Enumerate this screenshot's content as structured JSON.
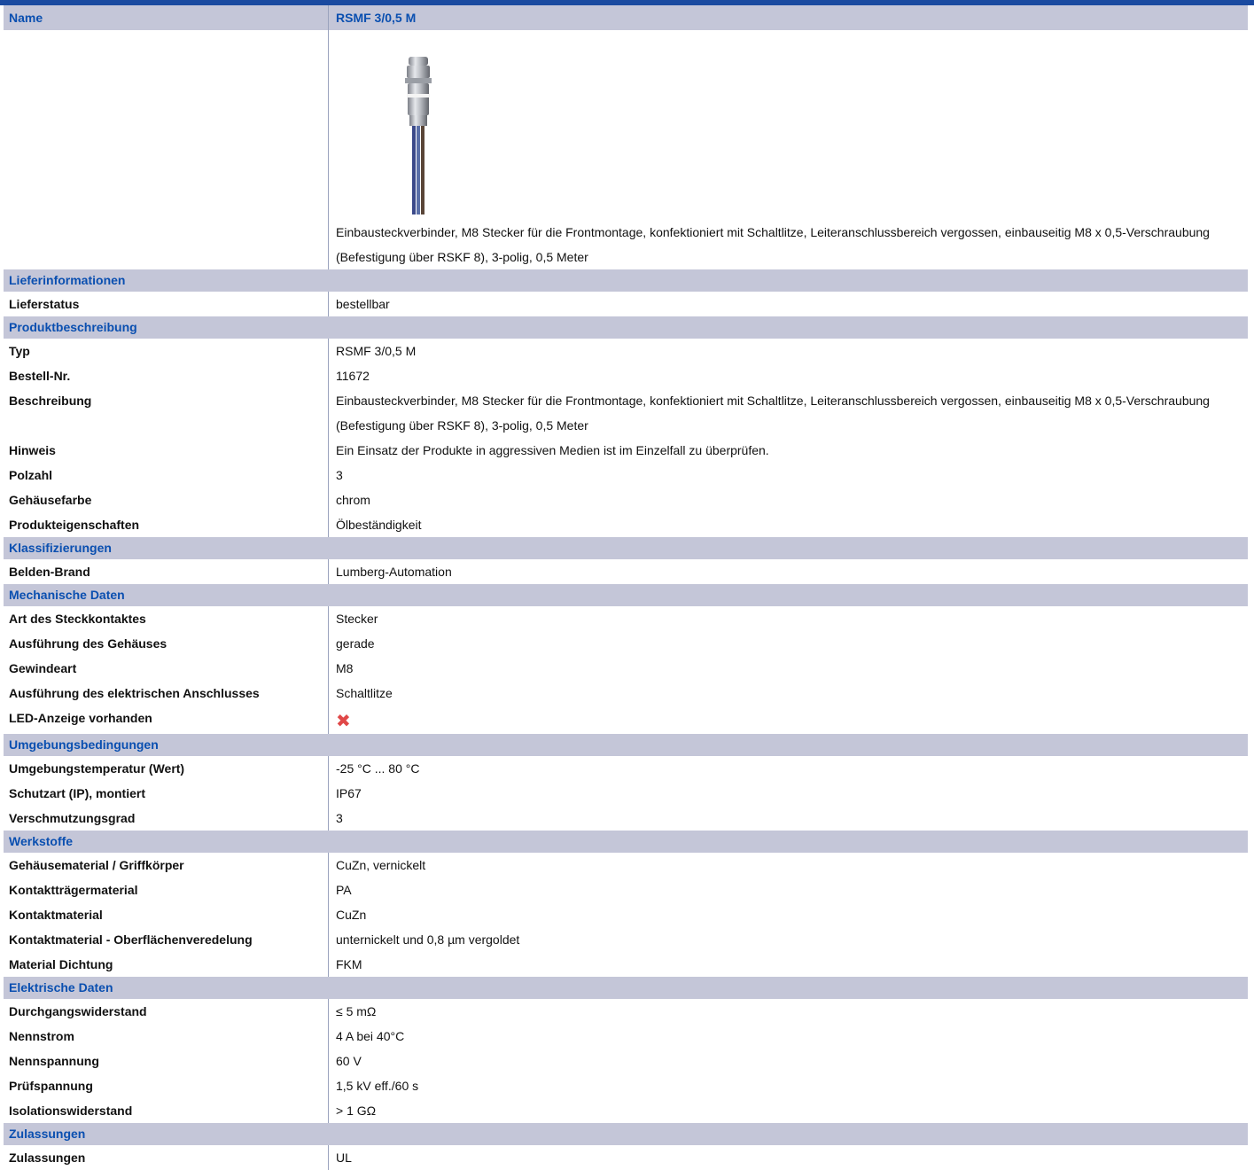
{
  "header": {
    "name_label": "Name",
    "name_value": "RSMF 3/0,5 M"
  },
  "intro_description": "Einbausteckverbinder, M8 Stecker für die Frontmontage, konfektioniert mit Schaltlitze, Leiteranschlussbereich vergossen, einbauseitig M8 x 0,5-Verschraubung (Befestigung über RSKF 8), 3-polig, 0,5 Meter",
  "sections": {
    "liefer": "Lieferinformationen",
    "produkt": "Produktbeschreibung",
    "klass": "Klassifizierungen",
    "mech": "Mechanische Daten",
    "umgebung": "Umgebungsbedingungen",
    "werk": "Werkstoffe",
    "elek": "Elektrische Daten",
    "zul": "Zulassungen"
  },
  "rows": {
    "lieferstatus": {
      "label": "Lieferstatus",
      "value": "bestellbar"
    },
    "typ": {
      "label": "Typ",
      "value": "RSMF 3/0,5 M"
    },
    "bestellnr": {
      "label": "Bestell-Nr.",
      "value": "11672"
    },
    "beschreibung": {
      "label": "Beschreibung",
      "value": "Einbausteckverbinder, M8 Stecker für die Frontmontage, konfektioniert mit Schaltlitze, Leiteranschlussbereich vergossen, einbauseitig M8 x 0,5-Verschraubung (Befestigung über RSKF 8), 3-polig, 0,5 Meter"
    },
    "hinweis": {
      "label": "Hinweis",
      "value": "Ein Einsatz der Produkte in aggressiven Medien ist im Einzelfall zu überprüfen."
    },
    "polzahl": {
      "label": "Polzahl",
      "value": "3"
    },
    "farbe": {
      "label": "Gehäusefarbe",
      "value": "chrom"
    },
    "eigenschaften": {
      "label": "Produkteigenschaften",
      "value": "Ölbeständigkeit"
    },
    "brand": {
      "label": "Belden-Brand",
      "value": "Lumberg-Automation"
    },
    "kontaktart": {
      "label": "Art des Steckkontaktes",
      "value": "Stecker"
    },
    "gehaeuse": {
      "label": "Ausführung des Gehäuses",
      "value": "gerade"
    },
    "gewinde": {
      "label": "Gewindeart",
      "value": "M8"
    },
    "anschluss": {
      "label": "Ausführung des elektrischen Anschlusses",
      "value": "Schaltlitze"
    },
    "led": {
      "label": "LED-Anzeige vorhanden",
      "value_icon": "cross-icon",
      "icon_color": "#e04848"
    },
    "temp": {
      "label": "Umgebungstemperatur (Wert)",
      "value": "-25 °C ... 80 °C"
    },
    "schutzart": {
      "label": "Schutzart (IP), montiert",
      "value": "IP67"
    },
    "verschmutzung": {
      "label": "Verschmutzungsgrad",
      "value": "3"
    },
    "griffkoerper": {
      "label": "Gehäusematerial / Griffkörper",
      "value": "CuZn, vernickelt"
    },
    "traeger": {
      "label": "Kontaktträgermaterial",
      "value": "PA"
    },
    "kontaktmat": {
      "label": "Kontaktmaterial",
      "value": "CuZn"
    },
    "oberflaeche": {
      "label": "Kontaktmaterial - Oberflächenveredelung",
      "value": "unternickelt und 0,8 µm vergoldet"
    },
    "dichtung": {
      "label": "Material Dichtung",
      "value": "FKM"
    },
    "durchgang": {
      "label": "Durchgangswiderstand",
      "value": "≤ 5 mΩ"
    },
    "nennstrom": {
      "label": "Nennstrom",
      "value": "4 A bei 40°C"
    },
    "nennspannung": {
      "label": "Nennspannung",
      "value": "60 V"
    },
    "pruef": {
      "label": "Prüfspannung",
      "value": "1,5 kV eff./60 s"
    },
    "isolation": {
      "label": "Isolationswiderstand",
      "value": "> 1 GΩ"
    },
    "zulassungen": {
      "label": "Zulassungen",
      "value": "UL"
    }
  },
  "colors": {
    "accent": "#0a4fb0",
    "section_bg": "#c4c6d8",
    "topbar": "#1a4aa0"
  }
}
